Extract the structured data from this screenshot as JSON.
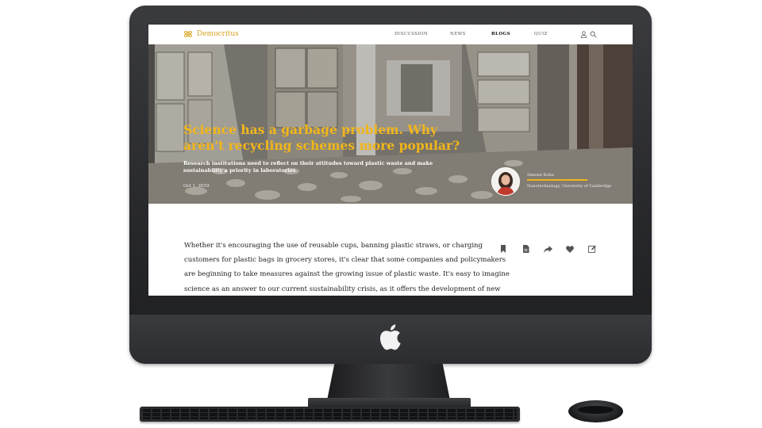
{
  "site": {
    "name": "Democritus",
    "brand_color": "#f2b61a"
  },
  "nav": {
    "links": [
      {
        "label": "DISCUSSION",
        "active": false
      },
      {
        "label": "NEWS",
        "active": false
      },
      {
        "label": "BLOGS",
        "active": true
      },
      {
        "label": "QUIZ",
        "active": false
      }
    ],
    "icons": [
      "user-icon",
      "search-icon"
    ]
  },
  "hero": {
    "title": "Science has a garbage problem. Why aren't recycling schemes more popular?",
    "subtitle": "Research institutions need to reflect on their attitudes toward plastic waste and make sustainability a priority in laboratories",
    "date": "Oct 1, 2019",
    "author_name": "Simone Kuhn",
    "author_role": "Nanotechnology, University of Cambridge"
  },
  "article": {
    "lines": [
      "Whether it's encouraging the use of reusable cups, banning plastic straws, or charging",
      "customers for plastic bags in grocery stores, it's clear that some companies and policymakers",
      "are beginning to take measures against the growing issue of plastic waste. It's easy to imagine",
      "science as an answer to our current sustainability crisis, as it offers the development of new"
    ]
  },
  "toolbar": {
    "icons": [
      "bookmark-icon",
      "document-icon",
      "share-icon",
      "heart-icon",
      "edit-icon"
    ]
  },
  "device": {
    "hardware": "iMac",
    "logo": "apple-logo"
  }
}
